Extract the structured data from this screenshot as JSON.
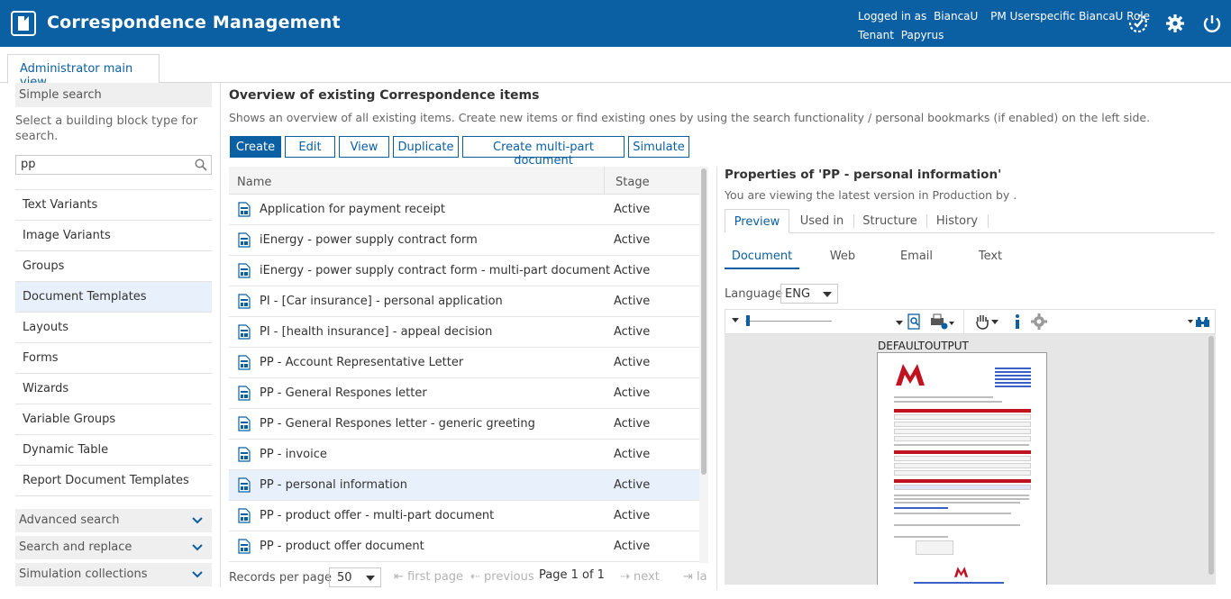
{
  "header": {
    "title": "Correspondence Management",
    "logged_in_label": "Logged in as",
    "user": "BiancaU",
    "role": "PM Userspecific BiancaU Role",
    "tenant_label": "Tenant",
    "tenant": "Papyrus",
    "icons": [
      "switch-role-icon",
      "settings-gear-icon",
      "power-icon"
    ],
    "brand_color": "#0b5fa3"
  },
  "tabs": [
    {
      "label": "Administrator main view",
      "active": true
    }
  ],
  "left": {
    "simple_search_title": "Simple search",
    "description": "Select a building block type for search.",
    "search_value": "pp",
    "types": [
      {
        "label": "Text Variants"
      },
      {
        "label": "Image Variants"
      },
      {
        "label": "Groups"
      },
      {
        "label": "Document Templates",
        "selected": true
      },
      {
        "label": "Layouts"
      },
      {
        "label": "Forms"
      },
      {
        "label": "Wizards"
      },
      {
        "label": "Variable Groups"
      },
      {
        "label": "Dynamic Table"
      },
      {
        "label": "Report Document Templates"
      }
    ],
    "accordions": [
      "Advanced search",
      "Search and replace",
      "Simulation collections"
    ]
  },
  "overview": {
    "title": "Overview of existing Correspondence items",
    "description": "Shows an overview of all existing items. Create new items or find existing ones by using the search functionality / personal bookmarks (if enabled) on the left side.",
    "buttons": [
      "Create",
      "Edit",
      "View",
      "Duplicate",
      "Create multi-part document",
      "Simulate"
    ],
    "columns": [
      "Name",
      "Stage"
    ],
    "rows": [
      {
        "name": "Application for payment receipt",
        "stage": "Active"
      },
      {
        "name": "iEnergy - power supply contract form",
        "stage": "Active"
      },
      {
        "name": "iEnergy - power supply contract form - multi-part document",
        "stage": "Active"
      },
      {
        "name": "PI - [Car insurance] - personal application",
        "stage": "Active"
      },
      {
        "name": "PI - [health insurance] - appeal decision",
        "stage": "Active"
      },
      {
        "name": "PP - Account Representative Letter",
        "stage": "Active"
      },
      {
        "name": "PP - General Respones letter",
        "stage": "Active"
      },
      {
        "name": "PP - General Respones letter - generic greeting",
        "stage": "Active"
      },
      {
        "name": "PP - invoice",
        "stage": "Active"
      },
      {
        "name": "PP - personal information",
        "stage": "Active",
        "selected": true
      },
      {
        "name": "PP - product offer - multi-part document",
        "stage": "Active"
      },
      {
        "name": "PP - product offer document",
        "stage": "Active"
      }
    ],
    "pager": {
      "records_per_page_label": "Records per page",
      "records_per_page": "50",
      "first": "first page",
      "previous": "previous",
      "page_text": "Page 1 of 1",
      "next": "next",
      "last": "la"
    }
  },
  "properties": {
    "title": "Properties of 'PP - personal information'",
    "subtitle": "You are viewing the latest version in Production by .",
    "tabs": [
      "Preview",
      "Used in",
      "Structure",
      "History"
    ],
    "active_tab": "Preview",
    "subtabs": [
      "Document",
      "Web",
      "Email",
      "Text"
    ],
    "active_subtab": "Document",
    "language_label": "Language",
    "language": "ENG",
    "output_label": "DEFAULTOUTPUT"
  }
}
